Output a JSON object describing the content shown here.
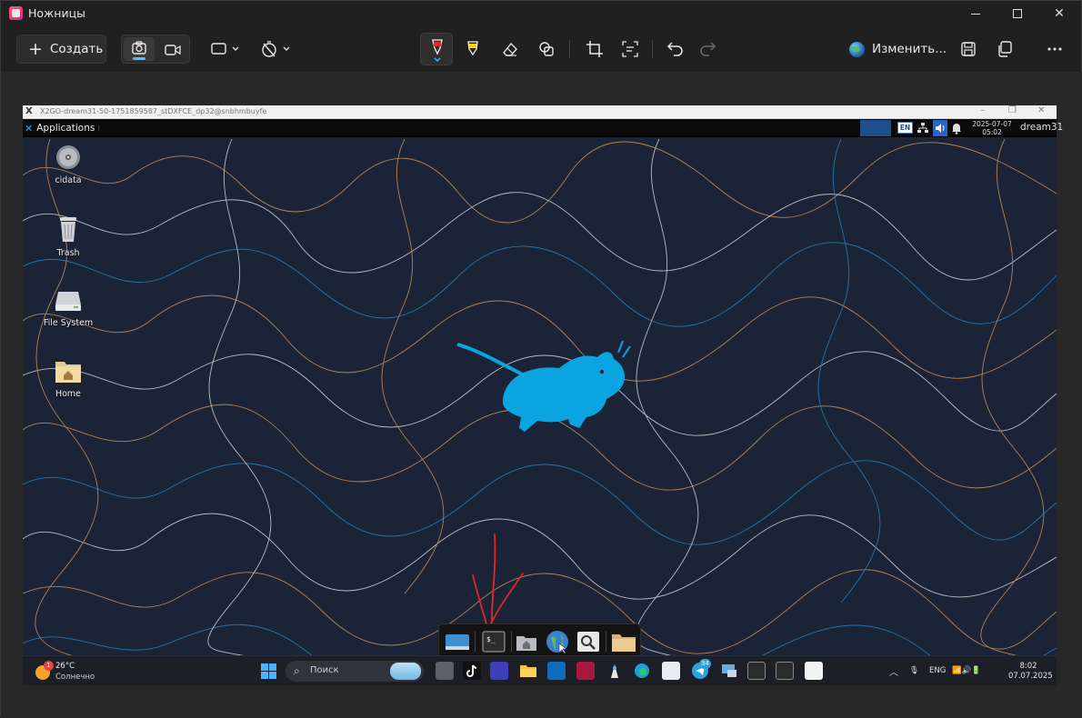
{
  "window": {
    "title": "Ножницы"
  },
  "toolbar": {
    "create_label": "Создать",
    "edit_label": "Изменить..."
  },
  "x2go": {
    "title": "X2GO-dream31-50-1751859587_stDXFCE_dp32@snbhmbuyfe"
  },
  "panel": {
    "apps_label": "Applications",
    "lang_badge": "EN",
    "date": "2025-07-07",
    "time": "05:02",
    "user": "dream31"
  },
  "desktop_icons": [
    {
      "label": "cidata",
      "icon": "cd-disc-icon"
    },
    {
      "label": "Trash",
      "icon": "trash-icon"
    },
    {
      "label": "File System",
      "icon": "drive-icon"
    },
    {
      "label": "Home",
      "icon": "home-folder-icon"
    }
  ],
  "dock": {
    "items": [
      "desktop-icon",
      "terminal-icon",
      "home-folder-icon",
      "web-browser-icon",
      "search-icon",
      "folder-icon"
    ]
  },
  "taskbar": {
    "weather_badge": "1",
    "weather_temp": "26°C",
    "weather_desc": "Солнечно",
    "search_placeholder": "Поиск",
    "telegram_badge": "34",
    "lang": "ENG",
    "time": "8:02",
    "date": "07.07.2025"
  },
  "colors": {
    "accent": "#4cc2ff",
    "annotation": "#e3262d",
    "xfce_mouse": "#0aa5e0",
    "desktop_bg": "#1a2436"
  }
}
